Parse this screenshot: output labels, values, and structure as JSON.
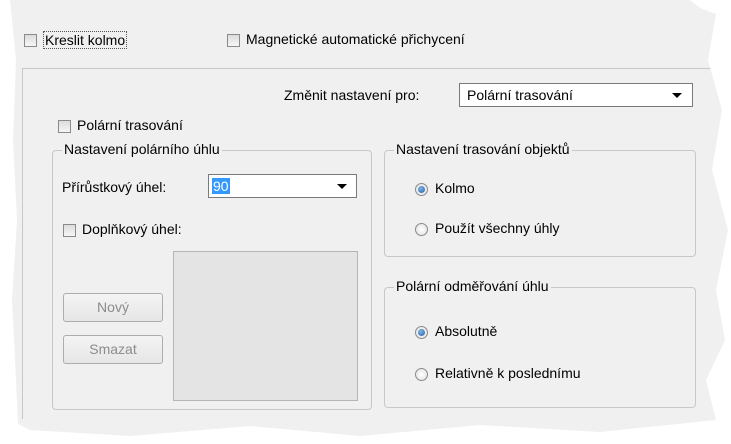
{
  "top": {
    "kreslit_kolmo": "Kreslit kolmo",
    "magneticke": "Magnetické automatické přichycení"
  },
  "change": {
    "label": "Změnit nastavení pro:",
    "value": "Polární trasování"
  },
  "polar_tracking": {
    "checkbox_label": "Polární trasování",
    "angle_group": {
      "title": "Nastavení polárního úhlu",
      "increment_label": "Přírůstkový úhel:",
      "increment_value": "90",
      "additional_label": "Doplňkový úhel:",
      "new_button": "Nový",
      "delete_button": "Smazat"
    },
    "object_tracking": {
      "title": "Nastavení trasování objektů",
      "option1": "Kolmo",
      "option2": "Použít všechny úhly"
    },
    "measurement": {
      "title": "Polární odměřování úhlu",
      "option1": "Absolutně",
      "option2": "Relativně k poslednímu"
    }
  }
}
